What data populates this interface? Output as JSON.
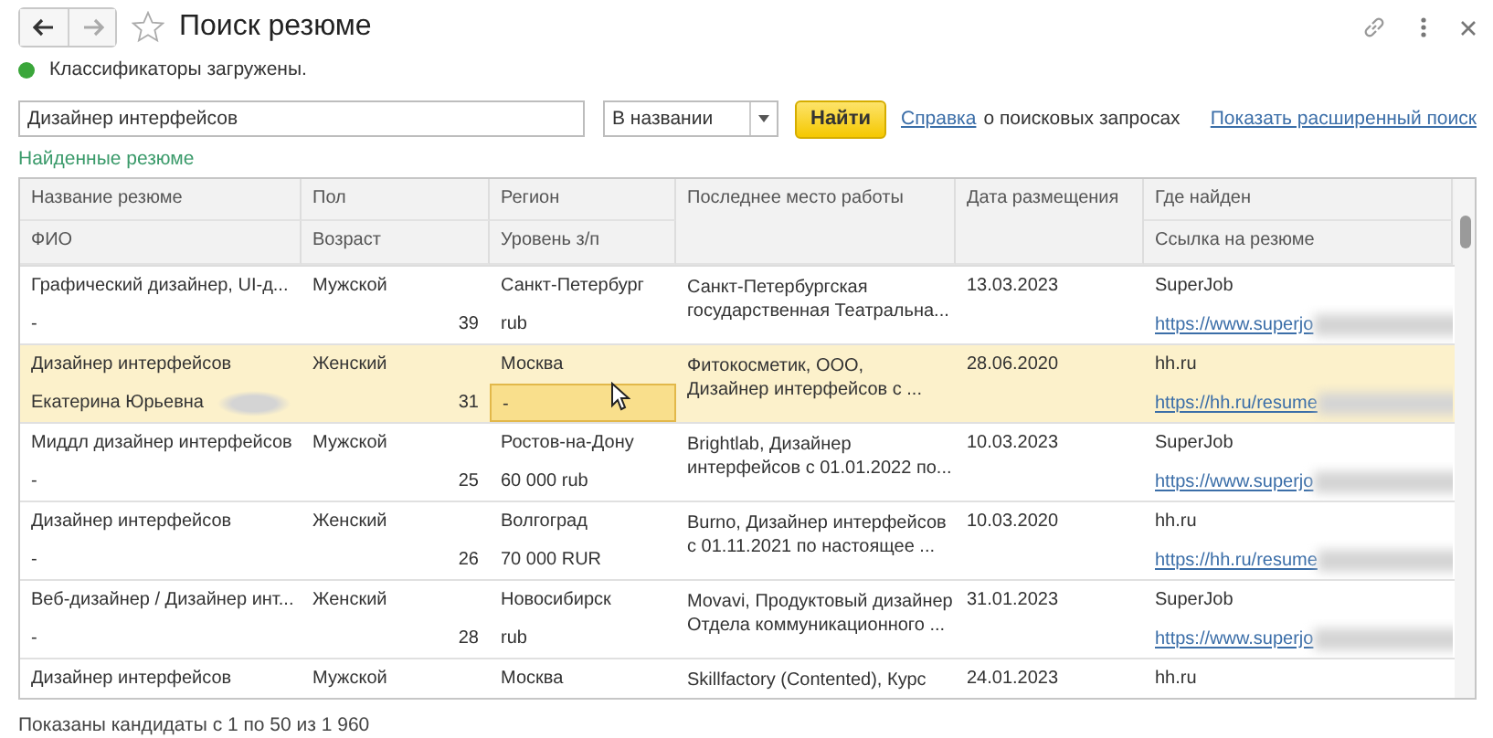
{
  "window": {
    "title": "Поиск резюме",
    "favorite": false
  },
  "status": {
    "text": "Классификаторы загружены.",
    "color": "#3aa63a"
  },
  "search": {
    "value": "Дизайнер интерфейсов",
    "scope": "В названии",
    "find_button": "Найти",
    "help_link": "Справка",
    "help_text": "о поисковых запросах",
    "advanced_link": "Показать расширенный поиск"
  },
  "section_title": "Найденные резюме",
  "table": {
    "columns": [
      {
        "top": "Название резюме",
        "bottom": "ФИО"
      },
      {
        "top": "Пол",
        "bottom": "Возраст"
      },
      {
        "top": "Регион",
        "bottom": "Уровень з/п"
      },
      {
        "top": "Последнее место работы"
      },
      {
        "top": "Дата размещения"
      },
      {
        "top": "Где найден",
        "bottom": "Ссылка на резюме"
      }
    ],
    "rows": [
      {
        "title": "Графический дизайнер, UI-д...",
        "gender": "Мужской",
        "region": "Санкт-Петербург",
        "work": [
          "Санкт-Петербургская",
          "государственная Театральна..."
        ],
        "date": "13.03.2023",
        "source": "SuperJob",
        "name": "-",
        "name_redacted": false,
        "age": "39",
        "salary": "rub",
        "link": "https://www.superjo",
        "selected": false
      },
      {
        "title": "Дизайнер интерфейсов",
        "gender": "Женский",
        "region": "Москва",
        "work": [
          "Фитокосметик, ООО,",
          "Дизайнер интерфейсов с ..."
        ],
        "date": "28.06.2020",
        "source": "hh.ru",
        "name": "Екатерина Юрьевна",
        "name_redacted": true,
        "age": "31",
        "salary": "-",
        "link": "https://hh.ru/resume",
        "selected": true
      },
      {
        "title": "Миддл дизайнер интерфейсов",
        "gender": "Мужской",
        "region": "Ростов-на-Дону",
        "work": [
          "Brightlab, Дизайнер",
          "интерфейсов с 01.01.2022 по..."
        ],
        "date": "10.03.2023",
        "source": "SuperJob",
        "name": "-",
        "name_redacted": false,
        "age": "25",
        "salary": "60 000 rub",
        "link": "https://www.superjo",
        "selected": false
      },
      {
        "title": "Дизайнер интерфейсов",
        "gender": "Женский",
        "region": "Волгоград",
        "work": [
          "Burno, Дизайнер интерфейсов",
          "с 01.11.2021 по настоящее ..."
        ],
        "date": "10.03.2020",
        "source": "hh.ru",
        "name": "-",
        "name_redacted": false,
        "age": "26",
        "salary": "70 000 RUR",
        "link": "https://hh.ru/resume",
        "selected": false
      },
      {
        "title": "Веб-дизайнер / Дизайнер инт...",
        "gender": "Женский",
        "region": "Новосибирск",
        "work": [
          "Movavi, Продуктовый дизайнер",
          "Отдела коммуникационного ..."
        ],
        "date": "31.01.2023",
        "source": "SuperJob",
        "name": "-",
        "name_redacted": false,
        "age": "28",
        "salary": "rub",
        "link": "https://www.superjo",
        "selected": false
      },
      {
        "title": "Дизайнер интерфейсов",
        "gender": "Мужской",
        "region": "Москва",
        "work": [
          "Skillfactory (Contented), Курс"
        ],
        "date": "24.01.2023",
        "source": "hh.ru",
        "selected": false
      }
    ]
  },
  "footer": "Показаны кандидаты с 1 по 50 из 1 960"
}
